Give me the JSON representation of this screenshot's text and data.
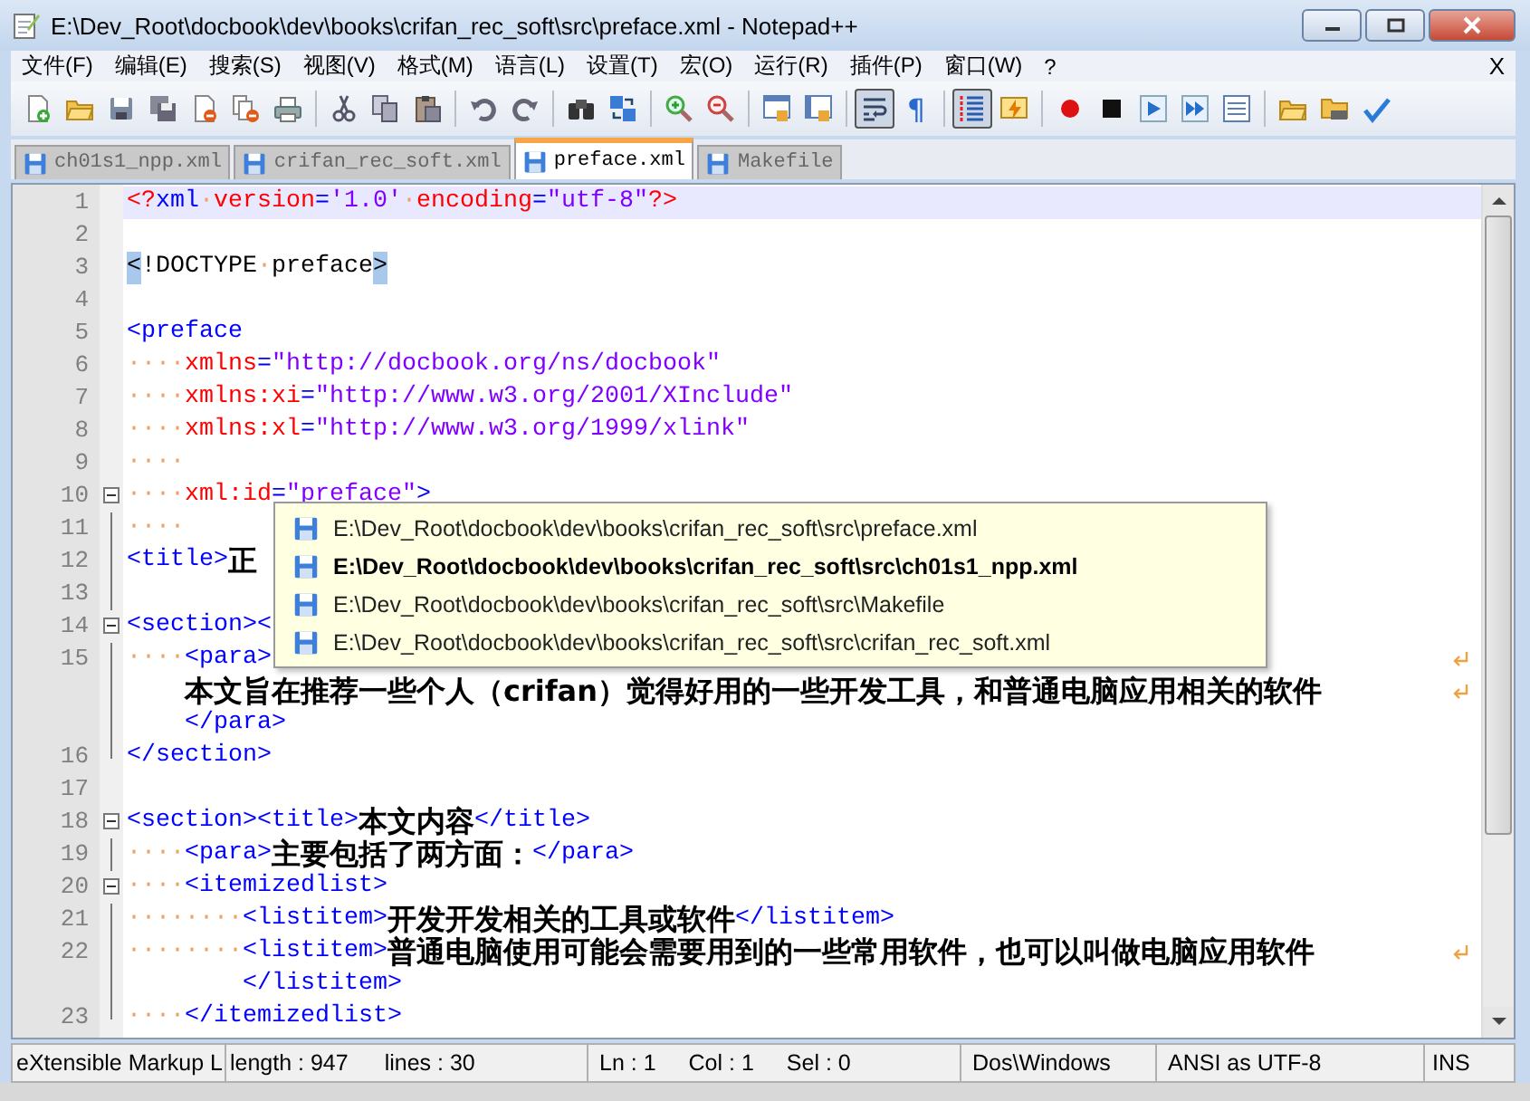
{
  "window": {
    "title": "E:\\Dev_Root\\docbook\\dev\\books\\crifan_rec_soft\\src\\preface.xml - Notepad++"
  },
  "menu": {
    "items": [
      "文件(F)",
      "编辑(E)",
      "搜索(S)",
      "视图(V)",
      "格式(M)",
      "语言(L)",
      "设置(T)",
      "宏(O)",
      "运行(R)",
      "插件(P)",
      "窗口(W)",
      "?"
    ],
    "close": "X"
  },
  "toolbar": [
    [
      {
        "kind": "new",
        "pressed": false
      },
      {
        "kind": "open",
        "pressed": false
      },
      {
        "kind": "save",
        "pressed": false
      },
      {
        "kind": "saveall",
        "pressed": false
      },
      {
        "kind": "close",
        "pressed": false
      },
      {
        "kind": "closeall",
        "pressed": false
      },
      {
        "kind": "print",
        "pressed": false
      }
    ],
    [
      {
        "kind": "cut",
        "pressed": false
      },
      {
        "kind": "copy",
        "pressed": false
      },
      {
        "kind": "paste",
        "pressed": false
      }
    ],
    [
      {
        "kind": "undo",
        "pressed": false
      },
      {
        "kind": "redo",
        "pressed": false
      }
    ],
    [
      {
        "kind": "find",
        "pressed": false
      },
      {
        "kind": "replace",
        "pressed": false
      }
    ],
    [
      {
        "kind": "zoomin",
        "pressed": false
      },
      {
        "kind": "zoomout",
        "pressed": false
      }
    ],
    [
      {
        "kind": "syncv",
        "pressed": false
      },
      {
        "kind": "synch",
        "pressed": false
      }
    ],
    [
      {
        "kind": "wrap",
        "pressed": true
      },
      {
        "kind": "glyph",
        "text": "¶",
        "pressed": false
      }
    ],
    [
      {
        "kind": "guide",
        "pressed": true
      },
      {
        "kind": "lightning",
        "pressed": false
      }
    ],
    [
      {
        "kind": "record",
        "pressed": false
      },
      {
        "kind": "stop",
        "pressed": false
      },
      {
        "kind": "play",
        "pressed": false
      },
      {
        "kind": "playmulti",
        "pressed": false
      },
      {
        "kind": "savemacro",
        "pressed": false
      }
    ],
    [
      {
        "kind": "open",
        "pressed": false
      },
      {
        "kind": "folderprint",
        "pressed": false
      },
      {
        "kind": "spell",
        "pressed": false
      }
    ]
  ],
  "tabs": [
    {
      "label": "ch01s1_npp.xml",
      "selected": false
    },
    {
      "label": "crifan_rec_soft.xml",
      "selected": false
    },
    {
      "label": "preface.xml",
      "selected": true
    },
    {
      "label": "Makefile",
      "selected": false
    }
  ],
  "lines": [
    {
      "number": "1",
      "fold_toggle": false,
      "in_fold": false,
      "current": true,
      "rows": [
        {
          "wrapped": false,
          "segments": [
            {
              "kind": "pi",
              "text": "<?"
            },
            {
              "kind": "tag",
              "text": "xml"
            },
            {
              "kind": "ws",
              "text": "·"
            },
            {
              "kind": "attr",
              "text": "version"
            },
            {
              "kind": "tag",
              "text": "="
            },
            {
              "kind": "value",
              "text": "'1.0'"
            },
            {
              "kind": "ws",
              "text": "·"
            },
            {
              "kind": "attr",
              "text": "encoding"
            },
            {
              "kind": "tag",
              "text": "="
            },
            {
              "kind": "value",
              "text": "\"utf-8\""
            },
            {
              "kind": "pi",
              "text": "?>"
            }
          ]
        }
      ]
    },
    {
      "number": "2",
      "fold_toggle": false,
      "in_fold": false,
      "current": false,
      "rows": [
        {
          "wrapped": false
        }
      ]
    },
    {
      "number": "3",
      "fold_toggle": false,
      "in_fold": false,
      "current": false,
      "rows": [
        {
          "wrapped": false,
          "segments": [
            {
              "kind": "match",
              "text": "<"
            },
            {
              "kind": "plain",
              "text": "!DOCTYPE"
            },
            {
              "kind": "ws",
              "text": "·"
            },
            {
              "kind": "plain",
              "text": "preface"
            },
            {
              "kind": "match",
              "text": ">"
            }
          ]
        }
      ]
    },
    {
      "number": "4",
      "fold_toggle": false,
      "in_fold": false,
      "current": false,
      "rows": [
        {
          "wrapped": false
        }
      ]
    },
    {
      "number": "5",
      "fold_toggle": false,
      "in_fold": false,
      "current": false,
      "rows": [
        {
          "wrapped": false,
          "segments": [
            {
              "kind": "tag",
              "text": "<preface"
            }
          ]
        }
      ]
    },
    {
      "number": "6",
      "fold_toggle": false,
      "in_fold": false,
      "current": false,
      "rows": [
        {
          "wrapped": false,
          "segments": [
            {
              "kind": "ws",
              "text": "····"
            },
            {
              "kind": "attr",
              "text": "xmlns"
            },
            {
              "kind": "tag",
              "text": "="
            },
            {
              "kind": "value",
              "text": "\"http://docbook.org/ns/docbook\""
            }
          ]
        }
      ]
    },
    {
      "number": "7",
      "fold_toggle": false,
      "in_fold": false,
      "current": false,
      "rows": [
        {
          "wrapped": false,
          "segments": [
            {
              "kind": "ws",
              "text": "····"
            },
            {
              "kind": "attr",
              "text": "xmlns:xi"
            },
            {
              "kind": "tag",
              "text": "="
            },
            {
              "kind": "value",
              "text": "\"http://www.w3.org/2001/XInclude\""
            }
          ]
        }
      ]
    },
    {
      "number": "8",
      "fold_toggle": false,
      "in_fold": false,
      "current": false,
      "rows": [
        {
          "wrapped": false,
          "segments": [
            {
              "kind": "ws",
              "text": "····"
            },
            {
              "kind": "attr",
              "text": "xmlns:xl"
            },
            {
              "kind": "tag",
              "text": "="
            },
            {
              "kind": "value",
              "text": "\"http://www.w3.org/1999/xlink\""
            }
          ]
        }
      ]
    },
    {
      "number": "9",
      "fold_toggle": false,
      "in_fold": false,
      "current": false,
      "rows": [
        {
          "wrapped": false,
          "segments": [
            {
              "kind": "ws",
              "text": "····"
            }
          ]
        }
      ]
    },
    {
      "number": "10",
      "fold_toggle": true,
      "in_fold": false,
      "current": false,
      "rows": [
        {
          "wrapped": false,
          "segments": [
            {
              "kind": "ws",
              "text": "····"
            },
            {
              "kind": "attr",
              "text": "xml:id"
            },
            {
              "kind": "tag",
              "text": "="
            },
            {
              "kind": "value",
              "text": "\"preface\""
            },
            {
              "kind": "tag",
              "text": ">"
            }
          ]
        }
      ]
    },
    {
      "number": "11",
      "fold_toggle": false,
      "in_fold": true,
      "current": false,
      "rows": [
        {
          "wrapped": false,
          "segments": [
            {
              "kind": "ws",
              "text": "····"
            }
          ]
        }
      ]
    },
    {
      "number": "12",
      "fold_toggle": false,
      "in_fold": true,
      "current": false,
      "rows": [
        {
          "wrapped": false,
          "segments": [
            {
              "kind": "tag",
              "text": "<title>"
            },
            {
              "kind": "text",
              "text": "正"
            }
          ]
        }
      ]
    },
    {
      "number": "13",
      "fold_toggle": false,
      "in_fold": true,
      "current": false,
      "rows": [
        {
          "wrapped": false
        }
      ]
    },
    {
      "number": "14",
      "fold_toggle": true,
      "in_fold": true,
      "current": false,
      "rows": [
        {
          "wrapped": false,
          "segments": [
            {
              "kind": "tag",
              "text": "<section><"
            }
          ]
        }
      ]
    },
    {
      "number": "15",
      "fold_toggle": false,
      "in_fold": true,
      "current": false,
      "rows": [
        {
          "wrapped": true,
          "segments": [
            {
              "kind": "ws",
              "text": "····"
            },
            {
              "kind": "tag",
              "text": "<para>"
            }
          ]
        },
        {
          "wrapped": true,
          "segments": [
            {
              "kind": "text",
              "text": "本文旨在推荐一些个人（crifan）觉得好用的一些开发工具，和普通电脑应用相关的软件"
            }
          ]
        },
        {
          "wrapped": false,
          "segments": [
            {
              "kind": "tag",
              "text": "</para>"
            }
          ]
        }
      ]
    },
    {
      "number": "16",
      "fold_toggle": false,
      "in_fold": true,
      "current": false,
      "rows": [
        {
          "wrapped": false,
          "segments": [
            {
              "kind": "tag",
              "text": "</section>"
            }
          ]
        }
      ]
    },
    {
      "number": "17",
      "fold_toggle": false,
      "in_fold": false,
      "current": false,
      "rows": [
        {
          "wrapped": false
        }
      ]
    },
    {
      "number": "18",
      "fold_toggle": true,
      "in_fold": false,
      "current": false,
      "rows": [
        {
          "wrapped": false,
          "segments": [
            {
              "kind": "tag",
              "text": "<section><title>"
            },
            {
              "kind": "text",
              "text": "本文内容"
            },
            {
              "kind": "tag",
              "text": "</title>"
            }
          ]
        }
      ]
    },
    {
      "number": "19",
      "fold_toggle": false,
      "in_fold": true,
      "current": false,
      "rows": [
        {
          "wrapped": false,
          "segments": [
            {
              "kind": "ws",
              "text": "····"
            },
            {
              "kind": "tag",
              "text": "<para>"
            },
            {
              "kind": "text",
              "text": "主要包括了两方面："
            },
            {
              "kind": "tag",
              "text": "</para>"
            }
          ]
        }
      ]
    },
    {
      "number": "20",
      "fold_toggle": true,
      "in_fold": true,
      "current": false,
      "rows": [
        {
          "wrapped": false,
          "segments": [
            {
              "kind": "ws",
              "text": "····"
            },
            {
              "kind": "tag",
              "text": "<itemizedlist>"
            }
          ]
        }
      ]
    },
    {
      "number": "21",
      "fold_toggle": false,
      "in_fold": true,
      "current": false,
      "rows": [
        {
          "wrapped": false,
          "segments": [
            {
              "kind": "ws",
              "text": "········"
            },
            {
              "kind": "tag",
              "text": "<listitem>"
            },
            {
              "kind": "text",
              "text": "开发开发相关的工具或软件"
            },
            {
              "kind": "tag",
              "text": "</listitem>"
            }
          ]
        }
      ]
    },
    {
      "number": "22",
      "fold_toggle": false,
      "in_fold": true,
      "current": false,
      "rows": [
        {
          "wrapped": true,
          "segments": [
            {
              "kind": "ws",
              "text": "········"
            },
            {
              "kind": "tag",
              "text": "<listitem>"
            },
            {
              "kind": "text",
              "text": "普通电脑使用可能会需要用到的一些常用软件，也可以叫做电脑应用软件"
            }
          ]
        },
        {
          "wrapped": false,
          "segments": [
            {
              "kind": "tag",
              "text": "</listitem>"
            }
          ]
        }
      ]
    },
    {
      "number": "23",
      "fold_toggle": false,
      "in_fold": true,
      "current": false,
      "rows": [
        {
          "wrapped": false,
          "segments": [
            {
              "kind": "ws",
              "text": "····"
            },
            {
              "kind": "tag",
              "text": "</itemizedlist>"
            }
          ]
        }
      ]
    }
  ],
  "popup": {
    "items": [
      {
        "path": "E:\\Dev_Root\\docbook\\dev\\books\\crifan_rec_soft\\src\\preface.xml",
        "selected": false
      },
      {
        "path": "E:\\Dev_Root\\docbook\\dev\\books\\crifan_rec_soft\\src\\ch01s1_npp.xml",
        "selected": true
      },
      {
        "path": "E:\\Dev_Root\\docbook\\dev\\books\\crifan_rec_soft\\src\\Makefile",
        "selected": false
      },
      {
        "path": "E:\\Dev_Root\\docbook\\dev\\books\\crifan_rec_soft\\src\\crifan_rec_soft.xml",
        "selected": false
      }
    ]
  },
  "status_bar": [
    {
      "texts": [
        "eXtensible Markup L"
      ]
    },
    {
      "texts": [
        "length : 947",
        "lines : 30"
      ]
    },
    {
      "texts": [
        "Ln : 1",
        "Col : 1",
        "Sel : 0"
      ]
    },
    {
      "texts": [
        "Dos\\Windows"
      ]
    },
    {
      "texts": [
        "ANSI as UTF-8"
      ]
    },
    {
      "texts": [
        "INS"
      ]
    }
  ]
}
